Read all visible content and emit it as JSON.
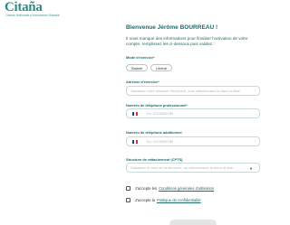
{
  "brand": {
    "name": "Citaña",
    "tagline": "Caisse Nationale d'Assurance Maladie"
  },
  "form": {
    "title": "Bienvenue Jérôme BOURREAU !",
    "intro": "Il nous manque des informations pour finaliser l'activation de votre compte, remplissez les ci-dessous puis validez :",
    "mode_label": "Mode d'exercice",
    "required_mark": "*",
    "mode_options": [
      "Salarié",
      "Libéral"
    ],
    "address_label": "Adresse d'exercice",
    "address_placeholder": "Saisissez votre adresse d'exercice, puis sélectionnez-la dans la liste",
    "phone_pro_label": "Numéro de téléphone professionnel",
    "phone_pro_placeholder": "Ex: 0123456789",
    "phone_extra_label": "Numéro de téléphone additionnel",
    "phone_extra_placeholder": "Ex: 0123456789",
    "cpts_label": "Structure de rattachement (CPTS)",
    "cpts_placeholder": "Saisissez le nom de la structure, ou sélectionnez-la dans la liste",
    "consent_cgu_prefix": "J'accepte les",
    "consent_cgu_link": "Conditions générales d'utilisation",
    "consent_privacy_prefix": "J'accepte la",
    "consent_privacy_link": "Politique de confidentialité"
  },
  "colors": {
    "brand": "#2a8a86",
    "heading": "#1e6b6a",
    "flag_blue": "#1f3c9a",
    "flag_red": "#e0303b"
  },
  "icons": {
    "flag": "france-flag-icon",
    "dropdown": "chevron-down-icon"
  }
}
